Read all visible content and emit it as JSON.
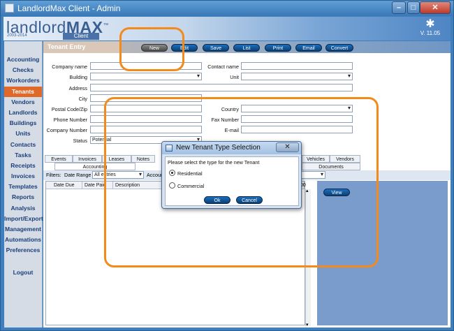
{
  "window": {
    "title": "LandlordMax Client - Admin",
    "controls": [
      "minimize-icon",
      "maximize-icon",
      "close-icon"
    ]
  },
  "banner": {
    "logo_text_light": "landlord",
    "logo_text_bold": "MAX",
    "logo_tm": "™",
    "logo_years": "2003-2014",
    "logo_sub": "Client",
    "version": "V. 11.05"
  },
  "sidebar": {
    "items": [
      {
        "label": "Accounting"
      },
      {
        "label": "Checks"
      },
      {
        "label": "Workorders"
      },
      {
        "label": "Tenants",
        "active": true
      },
      {
        "label": "Vendors"
      },
      {
        "label": "Landlords"
      },
      {
        "label": "Buildings"
      },
      {
        "label": "Units"
      },
      {
        "label": "Contacts"
      },
      {
        "label": "Tasks"
      },
      {
        "label": "Receipts"
      },
      {
        "label": "Invoices"
      },
      {
        "label": "Templates"
      },
      {
        "label": "Reports"
      },
      {
        "label": "Analysis"
      },
      {
        "label": "Import/Export"
      },
      {
        "label": "Management"
      },
      {
        "label": "Automations"
      },
      {
        "label": "Preferences"
      }
    ],
    "logout_label": "Logout"
  },
  "toolbar": {
    "section_title": "Tenant Entry",
    "buttons": [
      "New",
      "Edit",
      "Save",
      "List",
      "Print",
      "Email",
      "Convert"
    ]
  },
  "form": {
    "company_name": {
      "label": "Company name",
      "value": ""
    },
    "building": {
      "label": "Building",
      "value": ""
    },
    "address": {
      "label": "Address",
      "value": ""
    },
    "city": {
      "label": "City",
      "value": ""
    },
    "postal_code": {
      "label": "Postal Code/Zip",
      "value": ""
    },
    "phone": {
      "label": "Phone Number",
      "value": ""
    },
    "company_number": {
      "label": "Company Number",
      "value": ""
    },
    "status": {
      "label": "Status",
      "value": "Potential"
    },
    "contact_name": {
      "label": "Contact name",
      "value": ""
    },
    "unit": {
      "label": "Unit",
      "value": ""
    },
    "country": {
      "label": "Country",
      "value": ""
    },
    "fax": {
      "label": "Fax Number",
      "value": ""
    },
    "email": {
      "label": "E-mail",
      "value": ""
    }
  },
  "tabs_row1": [
    "Events",
    "Invoices",
    "Leases",
    "Notes",
    "Vehicles",
    "Vendors"
  ],
  "tabs_row2": [
    "Accounting",
    "Documents"
  ],
  "filters": {
    "label": "Filters:",
    "date_range_label": "Date Range",
    "date_range_value": "All entries",
    "account_label": "Account",
    "amount_fragment": "00"
  },
  "grid": {
    "columns": [
      "Date Due",
      "Date Paid",
      "Description"
    ]
  },
  "right_pane": {
    "view_button": "View"
  },
  "dialog": {
    "title": "New Tenant Type Selection",
    "close_glyph": "✕",
    "prompt": "Please select the type for the new Tenant",
    "options": [
      {
        "label": "Residential",
        "selected": true
      },
      {
        "label": "Commercial",
        "selected": false
      }
    ],
    "ok_label": "Ok",
    "cancel_label": "Cancel"
  },
  "colors": {
    "accent_active_nav": "#e0692a",
    "highlight_ring": "#f28a1c",
    "button_blue": "#0d3f73",
    "window_blue": "#3d7fbf"
  }
}
